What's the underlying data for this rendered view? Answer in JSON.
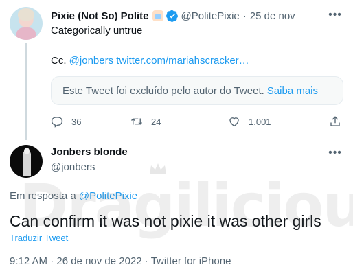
{
  "original_tweet": {
    "author_name": "Pixie (Not So) Polite",
    "author_handle": "@PolitePixie",
    "separator": "·",
    "date": "25 de nov",
    "text_line1": "Categorically untrue",
    "cc_prefix": "Cc.",
    "mention": "@jonbers",
    "link": "twitter.com/mariahscracker…",
    "quote_notice": "Este Tweet foi excluído pelo autor do Tweet.",
    "quote_link": "Saiba mais",
    "counts": {
      "replies": "36",
      "retweets": "24",
      "likes": "1.001"
    }
  },
  "reply_tweet": {
    "author_name": "Jonbers blonde",
    "author_handle": "@jonbers",
    "replying_prefix": "Em resposta a",
    "replying_to": "@PolitePixie",
    "text": "Can confirm it was not pixie it was other girls",
    "translate": "Traduzir Tweet",
    "meta": "9:12 AM · 26 de nov de 2022 · Twitter for iPhone"
  },
  "watermark": {
    "text": "Dragilicious"
  },
  "colors": {
    "accent": "#1d9bf0",
    "muted": "#536471",
    "text": "#0f1419",
    "border": "#e6ecf0"
  },
  "icons": [
    "more-icon",
    "reply-icon",
    "retweet-icon",
    "like-icon",
    "share-icon",
    "verified-icon"
  ]
}
